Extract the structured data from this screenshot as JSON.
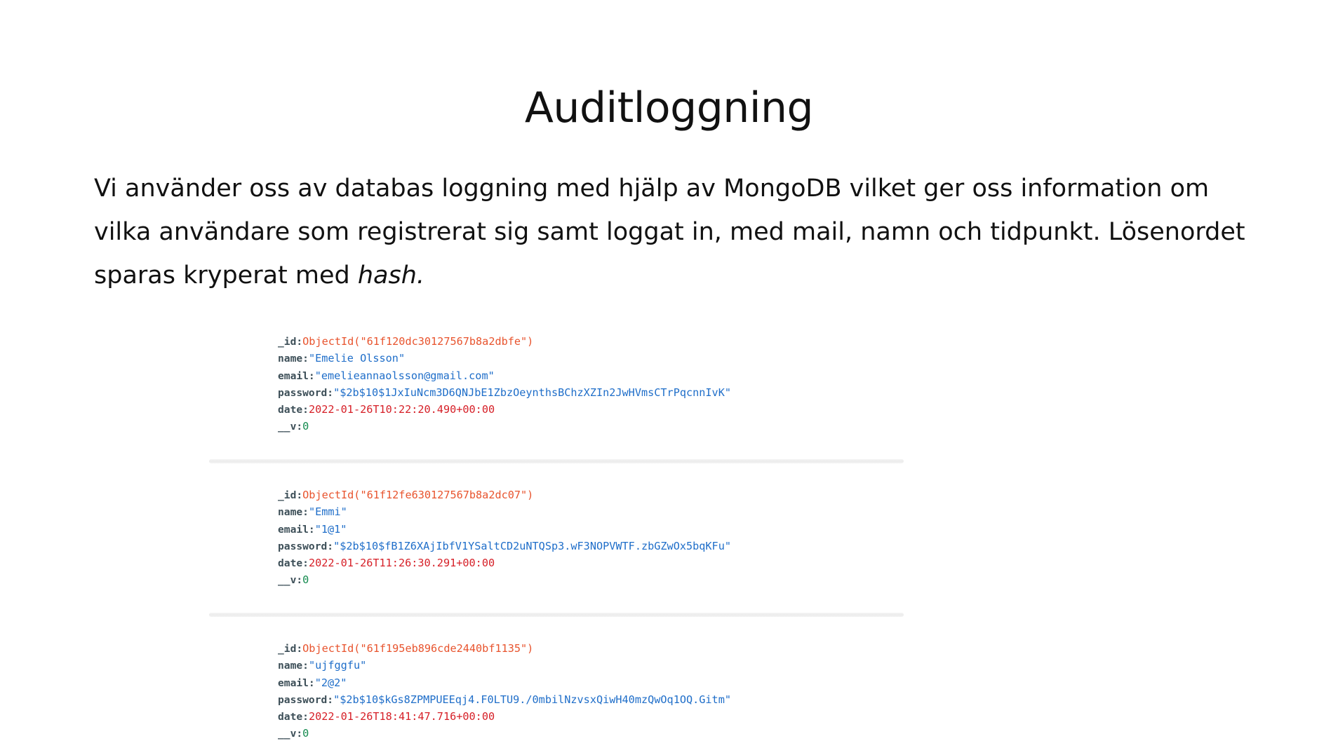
{
  "slide": {
    "title": "Auditloggning",
    "body_main": "Vi använder oss av databas loggning med hjälp av MongoDB vilket ger oss information om vilka användare som registrerat sig samt loggat in, med mail, namn och tidpunkt. Lösenordet sparas kryperat med ",
    "body_emphasis": "hash."
  },
  "field_keys": {
    "id": "_id:",
    "name": "name:",
    "email": "email:",
    "password": "password:",
    "date": "date:",
    "v": "__v:"
  },
  "documents": [
    {
      "id": "ObjectId(\"61f120dc30127567b8a2dbfe\")",
      "name": "\"Emelie Olsson\"",
      "email": "\"emelieannaolsson@gmail.com\"",
      "password": "\"$2b$10$1JxIuNcm3D6QNJbE1ZbzOeynthsBChzXZIn2JwHVmsCTrPqcnnIvK\"",
      "date": "2022-01-26T10:22:20.490+00:00",
      "v": "0"
    },
    {
      "id": "ObjectId(\"61f12fe630127567b8a2dc07\")",
      "name": "\"Emmi\"",
      "email": "\"1@1\"",
      "password": "\"$2b$10$fB1Z6XAjIbfV1YSaltCD2uNTQSp3.wF3NOPVWTF.zbGZwOx5bqKFu\"",
      "date": "2022-01-26T11:26:30.291+00:00",
      "v": "0"
    },
    {
      "id": "ObjectId(\"61f195eb896cde2440bf1135\")",
      "name": "\"ujfggfu\"",
      "email": "\"2@2\"",
      "password": "\"$2b$10$kGs8ZPMPUEEqj4.F0LTU9./0mbilNzvsxQiwH40mzQwOq1OQ.Gitm\"",
      "date": "2022-01-26T18:41:47.716+00:00",
      "v": "0"
    }
  ]
}
